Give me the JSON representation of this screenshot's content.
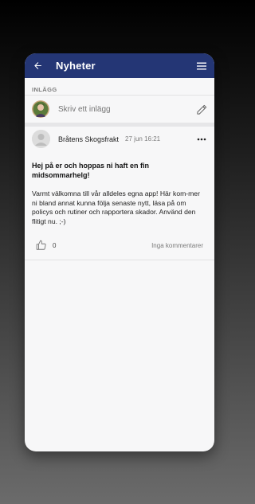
{
  "header": {
    "title": "Nyheter",
    "back_icon": "arrow-left-icon",
    "menu_icon": "hamburger-menu-icon"
  },
  "compose": {
    "section_label": "INLÄGG",
    "placeholder": "Skriv ett inlägg",
    "edit_icon": "pencil-icon"
  },
  "posts": [
    {
      "author": "Bråtens Skogsfrakt",
      "time": "27 jun 16:21",
      "title": "Hej på er och hoppas ni haft en fin midsommarhelg!",
      "body": "Varmt välkomna till vår alldeles egna app! Här kom-mer ni bland annat kunna följa senaste nytt, läsa på om policys och rutiner och rapportera skador. Använd den flitigt nu. ;-)",
      "likes": "0",
      "comments": "Inga kommentarer"
    }
  ],
  "colors": {
    "appbar": "#243675",
    "background": "#f7f7f8"
  }
}
